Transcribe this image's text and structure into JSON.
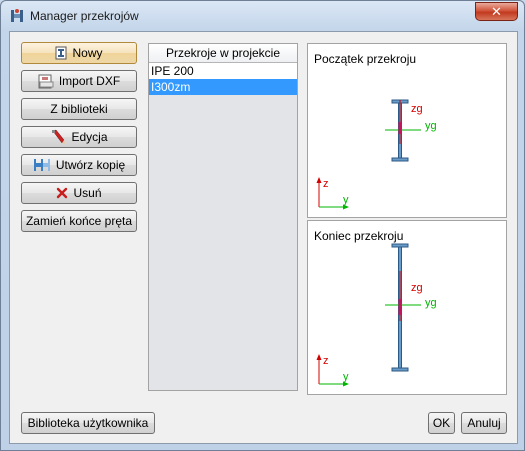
{
  "window": {
    "title": "Manager przekrojów",
    "close_symbol": "✕"
  },
  "actions": [
    {
      "label": "Nowy",
      "icon": "new-section-icon"
    },
    {
      "label": "Import DXF",
      "icon": "dxf-file-icon"
    },
    {
      "label": "Z biblioteki",
      "icon": ""
    },
    {
      "label": "Edycja",
      "icon": "pencil-icon"
    },
    {
      "label": "Utwórz kopię",
      "icon": "copy-icon"
    },
    {
      "label": "Usuń",
      "icon": "delete-x-icon"
    },
    {
      "label": "Zamień końce pręta",
      "icon": ""
    }
  ],
  "sections_list": {
    "header": "Przekroje w projekcie",
    "items": [
      "IPE 200",
      "I300zm"
    ],
    "selected_index": 1
  },
  "previews": {
    "start": {
      "title": "Początek przekroju",
      "axis_z": "z",
      "axis_y": "y",
      "label_zg": "zg",
      "label_yg": "yg"
    },
    "end": {
      "title": "Koniec przekroju",
      "axis_z": "z",
      "axis_y": "y",
      "label_zg": "zg",
      "label_yg": "yg"
    }
  },
  "footer": {
    "library_button": "Biblioteka użytkownika",
    "ok_button": "OK",
    "cancel_button": "Anuluj"
  },
  "colors": {
    "axis_red": "#d40000",
    "axis_green": "#00b400",
    "section_steel": "#2c5a86",
    "selection": "#3399ff"
  }
}
